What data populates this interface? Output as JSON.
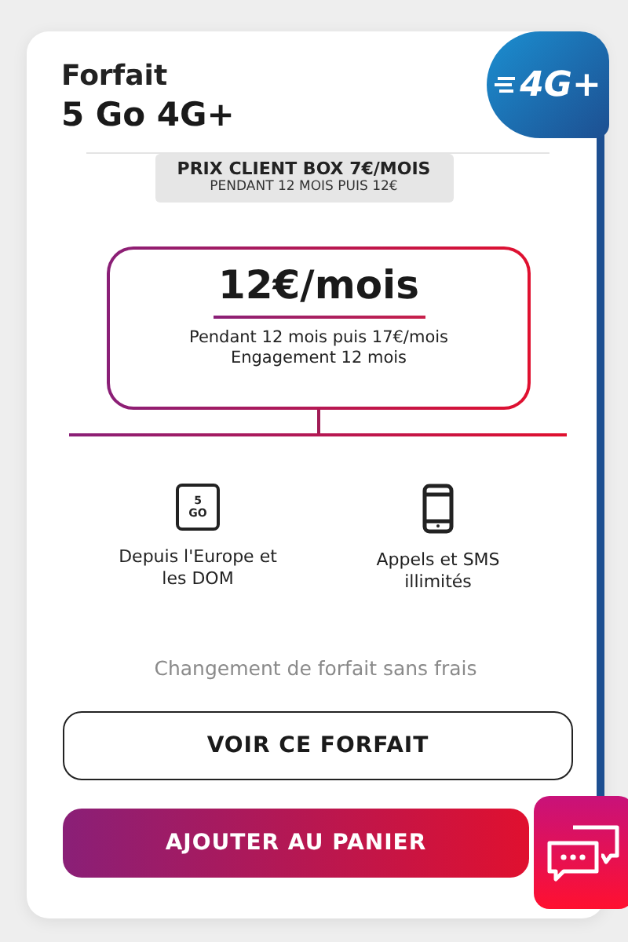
{
  "card": {
    "title": "Forfait",
    "subtitle": "5 Go 4G+",
    "badge": "4G+"
  },
  "promo": {
    "title": "PRIX CLIENT BOX 7€/MOIS",
    "subtitle": "PENDANT 12 MOIS PUIS 12€"
  },
  "price": {
    "amount": "12€/mois",
    "lines": [
      "Pendant 12 mois puis 17€/mois",
      "Engagement 12 mois"
    ]
  },
  "features": [
    {
      "kind": "data",
      "icon_lines": [
        "5",
        "GO"
      ],
      "label": "Depuis l'Europe et les DOM"
    },
    {
      "kind": "phone",
      "label": "Appels et SMS illimités"
    }
  ],
  "note": "Changement de forfait sans frais",
  "buttons": [
    {
      "kind": "outline",
      "label": "VOIR CE FORFAIT"
    },
    {
      "kind": "primary",
      "label": "AJOUTER AU PANIER"
    }
  ]
}
